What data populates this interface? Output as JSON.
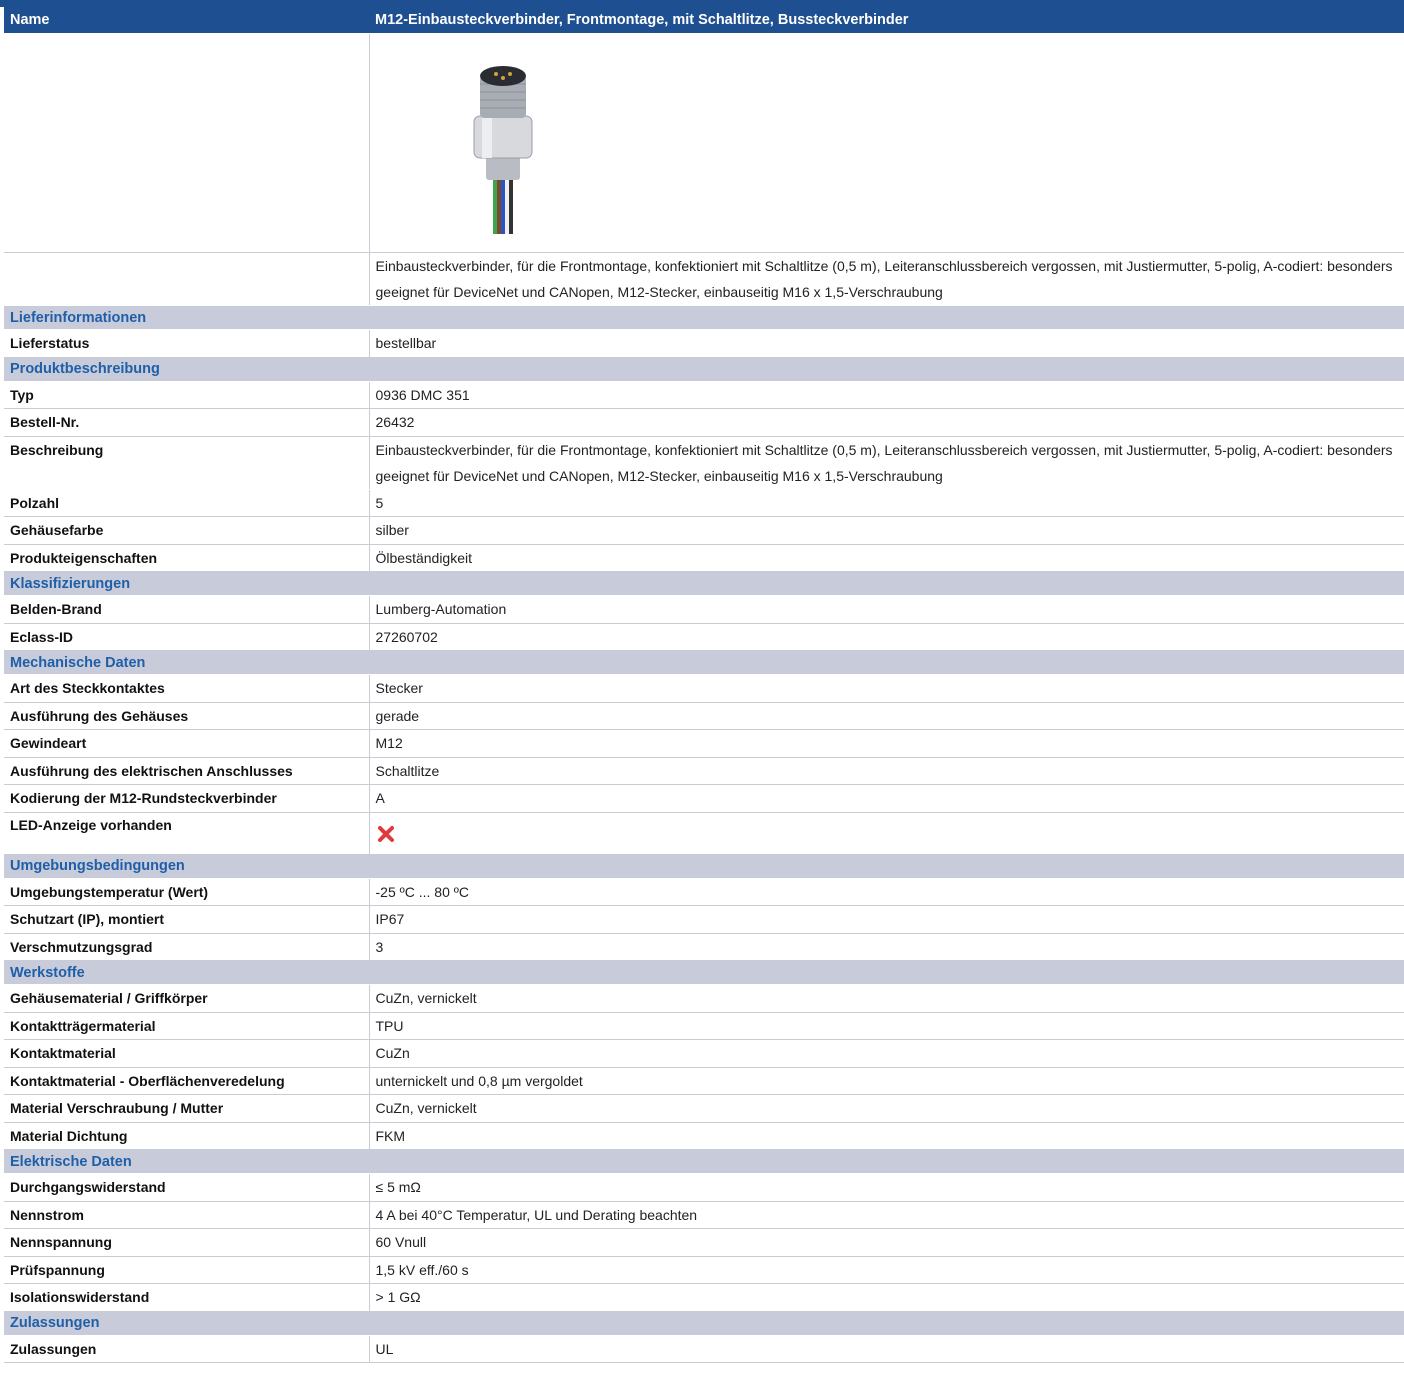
{
  "header": {
    "name_label": "Name",
    "name_value": "M12-Einbausteckverbinder, Frontmontage, mit Schaltlitze, Bussteckverbinder"
  },
  "intro_description": "Einbausteckverbinder, für die Frontmontage, konfektioniert mit Schaltlitze (0,5 m), Leiteranschlussbereich vergossen, mit Justiermutter, 5-polig, A-codiert: besonders geeignet für DeviceNet und CANopen, M12-Stecker, einbauseitig M16 x 1,5-Verschraubung",
  "sections": {
    "liefer": {
      "title": "Lieferinformationen",
      "rows": [
        {
          "label": "Lieferstatus",
          "value": "bestellbar"
        }
      ]
    },
    "produkt": {
      "title": "Produktbeschreibung",
      "rows": [
        {
          "label": "Typ",
          "value": "0936 DMC 351"
        },
        {
          "label": "Bestell-Nr.",
          "value": "26432"
        },
        {
          "label": "Beschreibung",
          "value": "Einbausteckverbinder, für die Frontmontage, konfektioniert mit Schaltlitze (0,5 m), Leiteranschlussbereich vergossen, mit Justiermutter, 5-polig, A-codiert: besonders geeignet für DeviceNet und CANopen, M12-Stecker, einbauseitig M16 x 1,5-Verschraubung"
        },
        {
          "label": "Polzahl",
          "value": "5"
        },
        {
          "label": "Gehäusefarbe",
          "value": "silber"
        },
        {
          "label": "Produkteigenschaften",
          "value": "Ölbeständigkeit"
        }
      ]
    },
    "klass": {
      "title": "Klassifizierungen",
      "rows": [
        {
          "label": "Belden-Brand",
          "value": "Lumberg-Automation"
        },
        {
          "label": "Eclass-ID",
          "value": "27260702"
        }
      ]
    },
    "mech": {
      "title": "Mechanische Daten",
      "rows": [
        {
          "label": "Art des Steckkontaktes",
          "value": "Stecker"
        },
        {
          "label": "Ausführung des Gehäuses",
          "value": "gerade"
        },
        {
          "label": "Gewindeart",
          "value": "M12"
        },
        {
          "label": "Ausführung des elektrischen Anschlusses",
          "value": "Schaltlitze"
        },
        {
          "label": "Kodierung der M12-Rundsteckverbinder",
          "value": "A"
        },
        {
          "label": "LED-Anzeige vorhanden",
          "icon": "red-x-icon"
        }
      ]
    },
    "umgeb": {
      "title": "Umgebungsbedingungen",
      "rows": [
        {
          "label": "Umgebungstemperatur (Wert)",
          "value": "-25 ºC ... 80 ºC"
        },
        {
          "label": "Schutzart (IP), montiert",
          "value": "IP67"
        },
        {
          "label": "Verschmutzungsgrad",
          "value": "3"
        }
      ]
    },
    "werk": {
      "title": "Werkstoffe",
      "rows": [
        {
          "label": "Gehäusematerial / Griffkörper",
          "value": "CuZn, vernickelt"
        },
        {
          "label": "Kontaktträgermaterial",
          "value": "TPU"
        },
        {
          "label": "Kontaktmaterial",
          "value": "CuZn"
        },
        {
          "label": "Kontaktmaterial - Oberflächenveredelung",
          "value": "unternickelt und 0,8 µm vergoldet"
        },
        {
          "label": "Material Verschraubung / Mutter",
          "value": "CuZn, vernickelt"
        },
        {
          "label": "Material Dichtung",
          "value": "FKM"
        }
      ]
    },
    "elek": {
      "title": "Elektrische Daten",
      "rows": [
        {
          "label": "Durchgangswiderstand",
          "value": "≤ 5 mΩ"
        },
        {
          "label": "Nennstrom",
          "value": "4 A bei 40°C Temperatur, UL und Derating beachten"
        },
        {
          "label": "Nennspannung",
          "value": "60 Vnull"
        },
        {
          "label": "Prüfspannung",
          "value": "1,5 kV eff./60 s"
        },
        {
          "label": "Isolationswiderstand",
          "value": "> 1 GΩ"
        }
      ]
    },
    "zul": {
      "title": "Zulassungen",
      "rows": [
        {
          "label": "Zulassungen",
          "value": "UL"
        }
      ]
    }
  },
  "colors": {
    "header_bg": "#1d4f91",
    "section_bg": "#c8cbd9",
    "section_text": "#1f5fa8",
    "x_icon": "#e0393e"
  }
}
